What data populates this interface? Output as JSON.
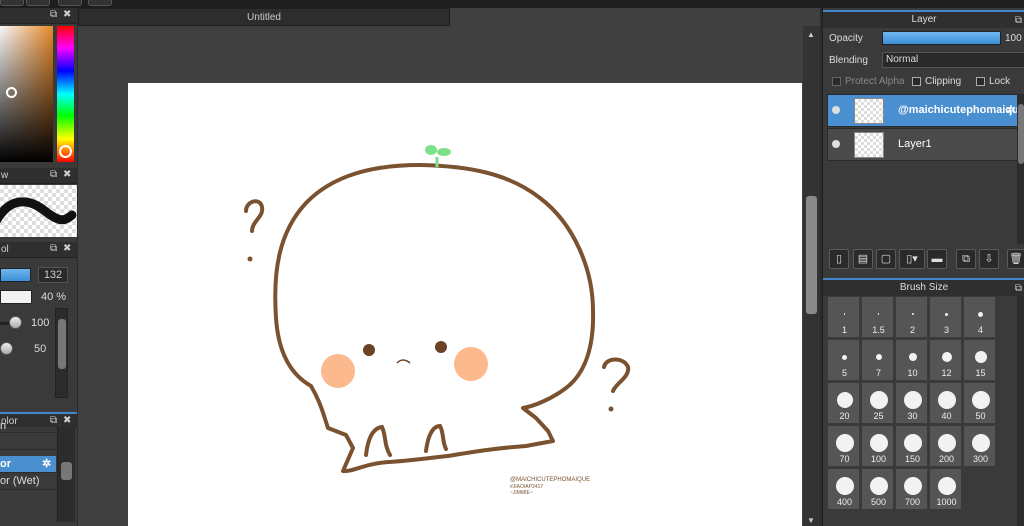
{
  "document": {
    "title": "Untitled"
  },
  "left_panels": {
    "brush_value": "132",
    "density_value": "40 %",
    "slider1_value": "100",
    "slider2_value": "50",
    "blend_modes": [
      "n",
      "",
      "",
      "or",
      "or (Wet)"
    ],
    "selected_blend_index": 3
  },
  "layer_panel": {
    "title": "Layer",
    "opacity_label": "Opacity",
    "opacity_value": "100",
    "blending_label": "Blending",
    "blending_value": "Normal",
    "protect_alpha_label": "Protect Alpha",
    "clipping_label": "Clipping",
    "lock_label": "Lock",
    "layers": [
      {
        "name": "@maichicutephomaique",
        "selected": true
      },
      {
        "name": "Layer1",
        "selected": false
      }
    ]
  },
  "brush_size_panel": {
    "title": "Brush Size",
    "sizes": [
      "1",
      "1.5",
      "2",
      "3",
      "4",
      "5",
      "7",
      "10",
      "12",
      "15",
      "20",
      "25",
      "30",
      "40",
      "50",
      "70",
      "100",
      "150",
      "200",
      "300",
      "400",
      "500",
      "700",
      "1000"
    ]
  },
  "artwork": {
    "watermark_line1": "@MAICHICUTEPHOMAIQUE",
    "watermark_line2": "#JIAOIAP2417",
    "watermark_line3": "~JIMMIE~",
    "colors": {
      "outline": "#7b5230",
      "blush": "#fdb98e",
      "sprout": "#7de08a",
      "eyes": "#6b4226"
    }
  },
  "colors": {
    "accent": "#4a90d0",
    "panel": "#3a3a3a",
    "canvas_bg": "#404040"
  }
}
